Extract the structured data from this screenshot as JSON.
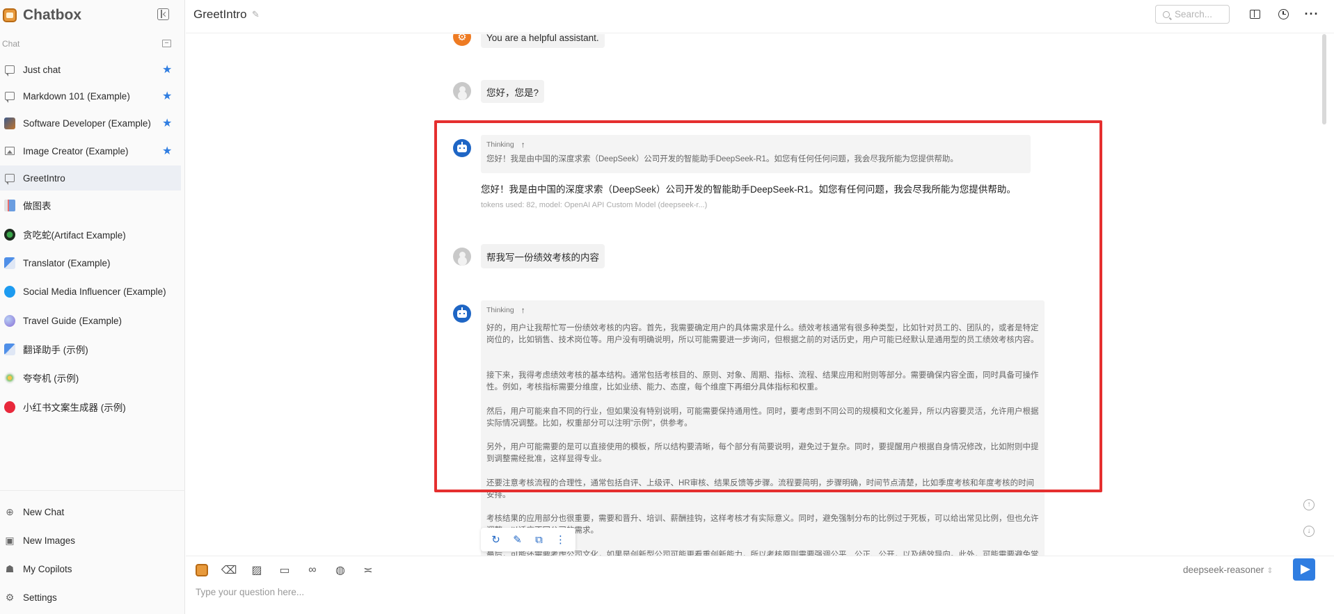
{
  "app": {
    "title": "Chatbox"
  },
  "sidebar": {
    "section_label": "Chat",
    "items": [
      {
        "label": "Just chat",
        "starred": true,
        "icon": "chat-bubble-icon"
      },
      {
        "label": "Markdown 101 (Example)",
        "starred": true,
        "icon": "chat-bubble-icon"
      },
      {
        "label": "Software Developer (Example)",
        "starred": true,
        "icon": "developer-avatar-icon"
      },
      {
        "label": "Image Creator (Example)",
        "starred": true,
        "icon": "image-icon"
      },
      {
        "label": "GreetIntro",
        "starred": false,
        "icon": "chat-bubble-icon",
        "active": true
      },
      {
        "label": "做图表",
        "starred": false,
        "icon": "chart-avatar-icon"
      },
      {
        "label": "贪吃蛇(Artifact Example)",
        "starred": false,
        "icon": "snake-avatar-icon"
      },
      {
        "label": "Translator (Example)",
        "starred": false,
        "icon": "translator-avatar-icon"
      },
      {
        "label": "Social Media Influencer (Example)",
        "starred": false,
        "icon": "twitter-avatar-icon"
      },
      {
        "label": "Travel Guide (Example)",
        "starred": false,
        "icon": "globe-avatar-icon"
      },
      {
        "label": "翻译助手 (示例)",
        "starred": false,
        "icon": "translator-avatar-icon"
      },
      {
        "label": "夸夸机 (示例)",
        "starred": false,
        "icon": "sparkle-avatar-icon"
      },
      {
        "label": "小红书文案生成器 (示例)",
        "starred": false,
        "icon": "xiaohongshu-avatar-icon"
      }
    ],
    "bottom": [
      {
        "label": "New Chat",
        "icon": "plus-circle-icon"
      },
      {
        "label": "New Images",
        "icon": "image-plus-icon"
      },
      {
        "label": "My Copilots",
        "icon": "robot-icon"
      },
      {
        "label": "Settings",
        "icon": "gear-icon"
      }
    ]
  },
  "header": {
    "title": "GreetIntro",
    "search_placeholder": "Search..."
  },
  "messages": {
    "system": "You are a helpful assistant.",
    "user1": "您好，您是?",
    "reply1": {
      "thinking_label": "Thinking",
      "thinking_text": "您好！我是由中国的深度求索（DeepSeek）公司开发的智能助手DeepSeek-R1。如您有任何任何问题，我会尽我所能为您提供帮助。",
      "answer": "您好！我是由中国的深度求索（DeepSeek）公司开发的智能助手DeepSeek-R1。如您有任何问题，我会尽我所能为您提供帮助。",
      "meta": "tokens used: 82, model: OpenAI API Custom Model (deepseek-r...)"
    },
    "user2": "帮我写一份绩效考核的内容",
    "reply2": {
      "thinking_label": "Thinking",
      "paragraphs": [
        "好的，用户让我帮忙写一份绩效考核的内容。首先，我需要确定用户的具体需求是什么。绩效考核通常有很多种类型，比如针对员工的、团队的，或者是特定岗位的，比如销售、技术岗位等。用户没有明确说明，所以可能需要进一步询问，但根据之前的对话历史，用户可能已经默认是通用型的员工绩效考核内容。",
        "接下来，我得考虑绩效考核的基本结构。通常包括考核目的、原则、对象、周期、指标、流程、结果应用和附则等部分。需要确保内容全面，同时具备可操作性。例如，考核指标需要分维度，比如业绩、能力、态度，每个维度下再细分具体指标和权重。",
        "然后，用户可能来自不同的行业，但如果没有特别说明，可能需要保持通用性。同时，要考虑到不同公司的规模和文化差异，所以内容要灵活，允许用户根据实际情况调整。比如，权重部分可以注明\"示例\"，供参考。",
        "另外，用户可能需要的是可以直接使用的模板，所以结构要清晰，每个部分有简要说明，避免过于复杂。同时，要提醒用户根据自身情况修改，比如附则中提到调整需经批准，这样显得专业。",
        "还要注意考核流程的合理性，通常包括自评、上级评、HR审核、结果反馈等步骤。流程要简明，步骤明确，时间节点清楚，比如季度考核和年度考核的时间安排。",
        "考核结果的应用部分也很重要，需要和晋升、培训、薪酬挂钩，这样考核才有实际意义。同时，避免强制分布的比例过于死板，可以给出常见比例，但也允许调整，以适应不同公司的需求。",
        "最后，可能还需要考虑公司文化，如果是创新型公司可能更看重创新能力，所以考核原则需要强调公平、公正、公开，以及绩效导向。此外，可能需要避免常"
      ]
    }
  },
  "toolbar_icons": [
    "regenerate-icon",
    "edit-icon",
    "copy-icon",
    "more-vertical-icon"
  ],
  "composer": {
    "placeholder": "Type your question here...",
    "model": "deepseek-reasoner",
    "tools": [
      "chatbox-logo-icon",
      "eraser-icon",
      "image-upload-icon",
      "folder-icon",
      "link-icon",
      "globe-icon",
      "settings-sliders-icon"
    ]
  },
  "colors": {
    "accent": "#2f7de1",
    "highlight_border": "#e52f2f",
    "system_avatar": "#ee7b23",
    "bot_avatar": "#1f66c5"
  }
}
